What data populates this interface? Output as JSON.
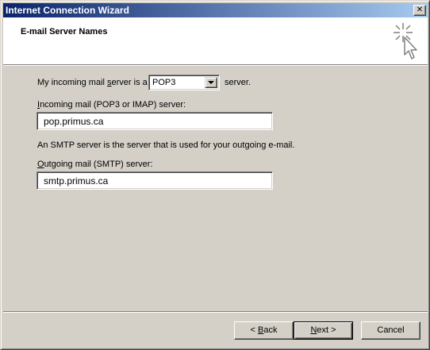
{
  "window": {
    "title": "Internet Connection Wizard",
    "close_glyph": "✕"
  },
  "header": {
    "title": "E-mail Server Names",
    "icon": "wizard-cursor-sparkle-icon"
  },
  "form": {
    "incoming_type_label_pre_u": "My incoming mail ",
    "incoming_type_label_u": "s",
    "incoming_type_label_post_u": "erver is a",
    "incoming_type_value": "POP3",
    "incoming_type_suffix": "server.",
    "incoming_server_label_u": "I",
    "incoming_server_label_rest": "ncoming mail (POP3 or IMAP) server:",
    "incoming_server_value": "pop.primus.ca",
    "smtp_info": "An SMTP server is the server that is used for your outgoing e-mail.",
    "outgoing_server_label_u": "O",
    "outgoing_server_label_rest": "utgoing mail (SMTP) server:",
    "outgoing_server_value": "smtp.primus.ca"
  },
  "buttons": {
    "back_pre": "< ",
    "back_u": "B",
    "back_post": "ack",
    "next_u": "N",
    "next_post": "ext >",
    "cancel": "Cancel"
  },
  "colors": {
    "title_gradient_start": "#0a246a",
    "title_gradient_end": "#a6caf0",
    "face": "#d4d0c8"
  }
}
